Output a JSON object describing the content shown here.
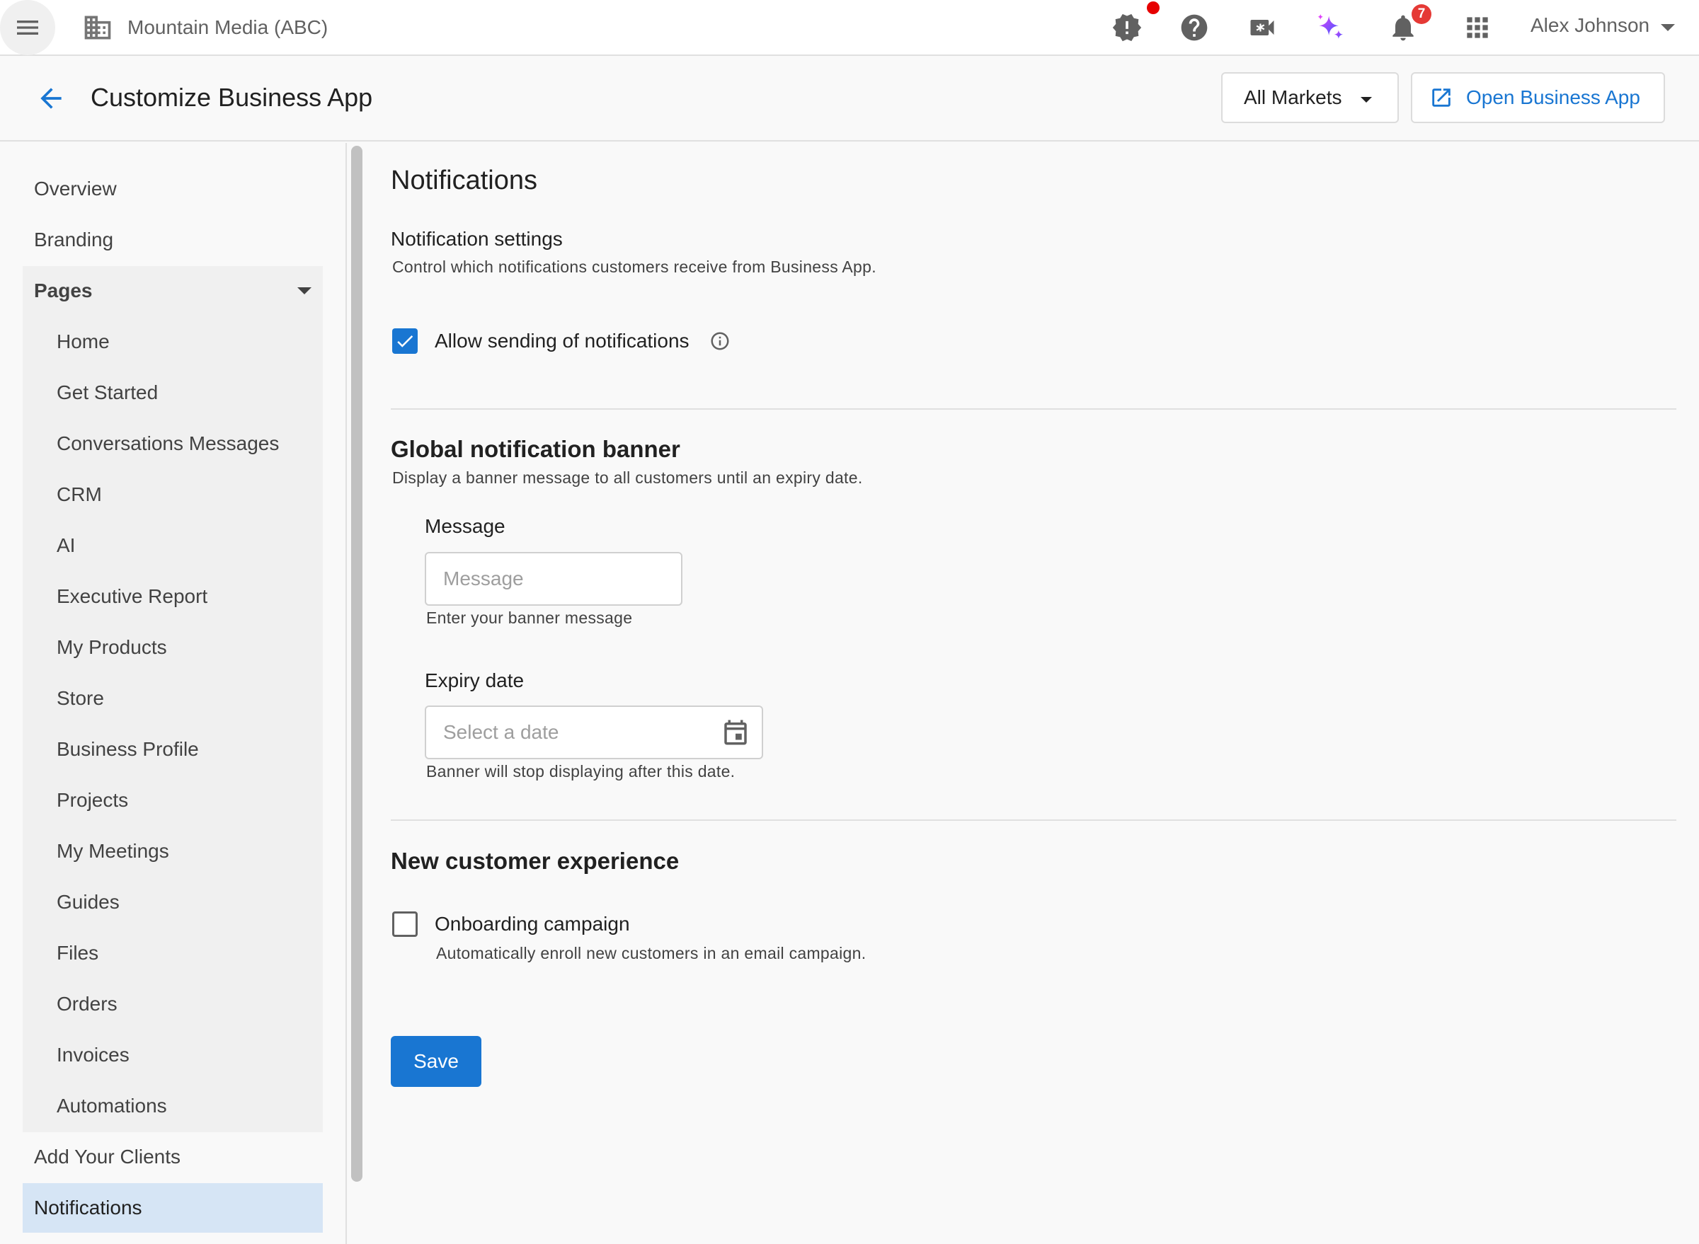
{
  "topbar": {
    "org_name": "Mountain Media (ABC)",
    "notification_count": "7",
    "user_name": "Alex Johnson",
    "icons": [
      "menu-icon",
      "building-icon",
      "alert-icon",
      "help-icon",
      "video-icon",
      "sparkle-icon",
      "bell-icon",
      "apps-grid-icon"
    ],
    "colors": {
      "accent": "#1976d2",
      "alert_dot": "#e60000",
      "badge": "#e53935"
    }
  },
  "header": {
    "title": "Customize Business App",
    "markets_label": "All Markets",
    "open_label": "Open Business App"
  },
  "sidebar": {
    "top_items": [
      {
        "label": "Overview"
      },
      {
        "label": "Branding"
      }
    ],
    "pages_label": "Pages",
    "pages": [
      {
        "label": "Home"
      },
      {
        "label": "Get Started"
      },
      {
        "label": "Conversations Messages"
      },
      {
        "label": "CRM"
      },
      {
        "label": "AI"
      },
      {
        "label": "Executive Report"
      },
      {
        "label": "My Products"
      },
      {
        "label": "Store"
      },
      {
        "label": "Business Profile"
      },
      {
        "label": "Projects"
      },
      {
        "label": "My Meetings"
      },
      {
        "label": "Guides"
      },
      {
        "label": "Files"
      },
      {
        "label": "Orders"
      },
      {
        "label": "Invoices"
      },
      {
        "label": "Automations"
      }
    ],
    "bottom_items": [
      {
        "label": "Add Your Clients"
      },
      {
        "label": "Notifications"
      }
    ],
    "active_item": "Notifications"
  },
  "main": {
    "title": "Notifications",
    "settings": {
      "heading": "Notification settings",
      "description": "Control which notifications customers receive from Business App.",
      "allow_label": "Allow sending of notifications",
      "allow_checked": true
    },
    "banner": {
      "heading": "Global notification banner",
      "description": "Display a banner message to all customers until an expiry date.",
      "message_label": "Message",
      "message_placeholder": "Message",
      "message_value": "",
      "message_hint": "Enter your banner message",
      "expiry_label": "Expiry date",
      "expiry_placeholder": "Select a date",
      "expiry_hint": "Banner will stop displaying after this date."
    },
    "new_customer": {
      "heading": "New customer experience",
      "onboarding_label": "Onboarding campaign",
      "onboarding_checked": false,
      "onboarding_description": "Automatically enroll new customers in an email campaign."
    },
    "save_label": "Save"
  }
}
